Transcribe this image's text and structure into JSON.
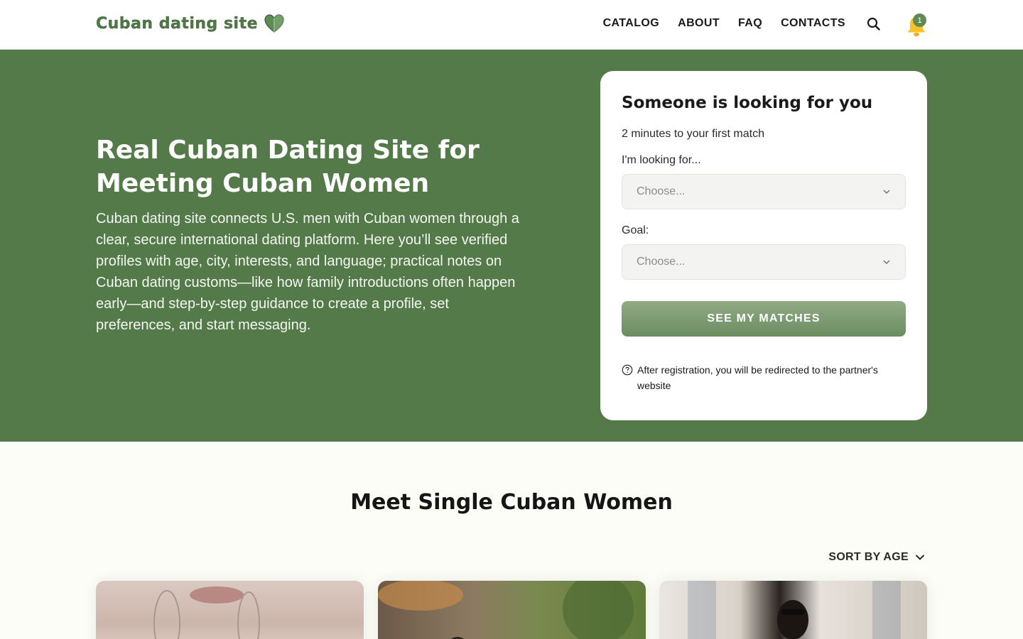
{
  "header": {
    "logo_text": "Cuban dating site",
    "nav": [
      "CATALOG",
      "ABOUT",
      "FAQ",
      "CONTACTS"
    ],
    "notification_count": "1"
  },
  "hero": {
    "title": "Real Cuban Dating Site for Meeting Cuban Women",
    "description": "Cuban dating site connects U.S. men with Cuban women through a clear, secure international dating platform. Here you’ll see verified profiles with age, city, interests, and language; practical notes on Cuban dating customs—like how family introductions often happen early—and step-by-step guidance to create a profile, set preferences, and start messaging."
  },
  "form": {
    "title": "Someone is looking for you",
    "subtitle": "2 minutes to your first match",
    "looking_for_label": "I'm looking for...",
    "looking_for_value": "Choose...",
    "goal_label": "Goal:",
    "goal_value": "Choose...",
    "submit_label": "SEE MY MATCHES",
    "note": "After registration, you will be redirected to the partner's website"
  },
  "catalog": {
    "title": "Meet Single Cuban Women",
    "sort_label": "SORT BY AGE"
  },
  "colors": {
    "brand_green": "#537a48",
    "button_green": "#7a9a6e",
    "bell_yellow": "#f6c12b"
  }
}
